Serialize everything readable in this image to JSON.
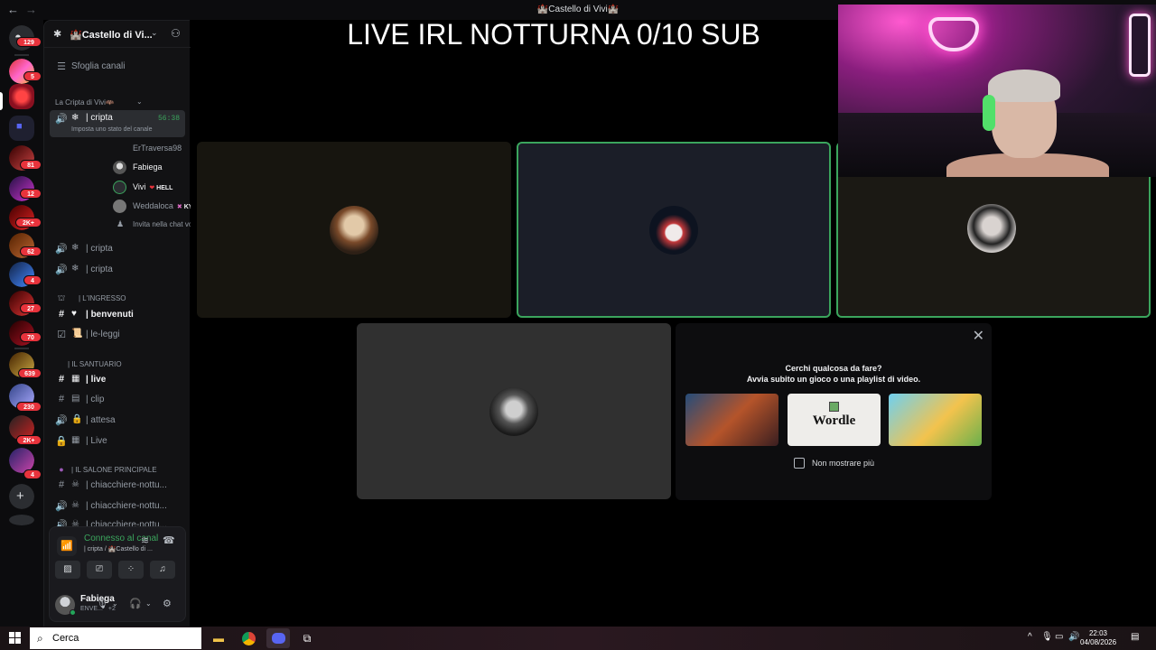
{
  "window": {
    "title": "🏰Castello di Vivi🏰"
  },
  "stream_overlay": {
    "title": "LIVE IRL NOTTURNA 0/10 SUB"
  },
  "rail": {
    "badges": [
      "129",
      "5",
      "81",
      "12",
      "2K+",
      "62",
      "4",
      "27",
      "70",
      "639",
      "230",
      "2K+",
      "4"
    ]
  },
  "server": {
    "name": "🏰Castello di Vi...",
    "browse_channels": "Sfoglia canali",
    "categories": {
      "cripta": "La Cripta di Vivi🦇",
      "ingresso": "| L'INGRESSO",
      "santuario": "| IL SANTUARIO",
      "salone": "| IL SALONE PRINCIPALE"
    },
    "channels": {
      "active_voice": "| cripta",
      "active_timer": "56:38",
      "active_status": "Imposta uno stato del canale",
      "cripta2": "| cripta",
      "cripta3": "| cripta",
      "benvenuti": "| benvenuti",
      "le_leggi": "| le-leggi",
      "live": "| live",
      "clip": "| clip",
      "attesa": "|  attesa",
      "live2": "| Live",
      "chiacchiere1": "| chiacchiere-nottu...",
      "chiacchiere2": "| chiacchiere-nottu...",
      "chiacchiere3": "| chiacchiere-nottu..."
    },
    "voice_users": [
      {
        "name": "ErTraversa98",
        "tag": ""
      },
      {
        "name": "Fabiega",
        "tag": ""
      },
      {
        "name": "Vivi",
        "tag": "HELL"
      },
      {
        "name": "Weddaloca",
        "tag": "KYRA"
      }
    ],
    "invite": "Invita nella chat vo..."
  },
  "voice_panel": {
    "status": "Connesso al canale voc",
    "location": "| cripta / 🏰Castello di ...",
    "user_name": "Fabiega",
    "user_status": "ENVE...",
    "user_extra": "+2"
  },
  "suggestion": {
    "line1": "Cerchi qualcosa da fare?",
    "line2": "Avvia subito un gioco o una playlist di video.",
    "games": [
      "Wordle"
    ],
    "dont_show": "Non mostrare più"
  },
  "taskbar": {
    "search_placeholder": "Cerca",
    "time": "22:03",
    "date": "04/08/2026"
  },
  "colors": {
    "speaking_green": "#3ba55d",
    "sidebar_bg": "#121214",
    "tile_dark": "#1a1a1c"
  }
}
